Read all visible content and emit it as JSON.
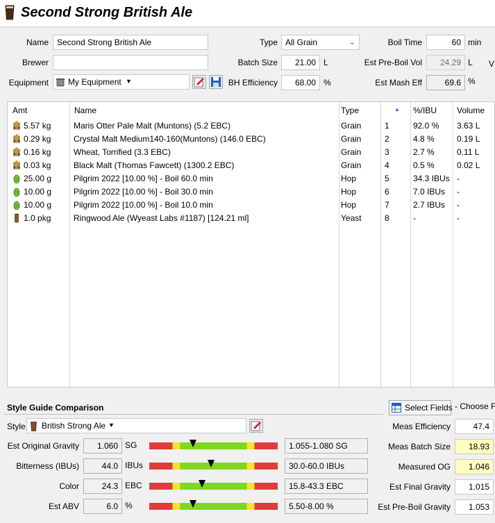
{
  "recipe": {
    "title": "Second Strong British Ale"
  },
  "form": {
    "name_label": "Name",
    "name_value": "Second Strong British Ale",
    "brewer_label": "Brewer",
    "brewer_value": "",
    "equipment_label": "Equipment",
    "equipment_value": "My Equipment",
    "type_label": "Type",
    "type_value": "All Grain",
    "batch_size_label": "Batch Size",
    "batch_size_value": "21.00",
    "batch_size_unit": "L",
    "bh_eff_label": "BH Efficiency",
    "bh_eff_value": "68.00",
    "bh_eff_unit": "%",
    "boil_time_label": "Boil Time",
    "boil_time_value": "60",
    "boil_time_unit": "min",
    "pre_boil_label": "Est Pre-Boil Vol",
    "pre_boil_value": "24.29",
    "pre_boil_unit": "L",
    "mash_eff_label": "Est Mash Eff",
    "mash_eff_value": "69.6",
    "mash_eff_unit": "%",
    "cut_letter": "V"
  },
  "table": {
    "headers": {
      "amt": "Amt",
      "name": "Name",
      "type": "Type",
      "pct": "%/IBU",
      "volume": "Volume"
    },
    "rows": [
      {
        "icon": "grain-icon",
        "amt": "5.57 kg",
        "name": "Maris Otter Pale Malt (Muntons) (5.2 EBC)",
        "type": "Grain",
        "num": "1",
        "pct": "92.0 %",
        "volume": "3.63 L"
      },
      {
        "icon": "grain-icon",
        "amt": "0.29 kg",
        "name": "Crystal Malt Medium140-160(Muntons) (146.0 EBC)",
        "type": "Grain",
        "num": "2",
        "pct": "4.8 %",
        "volume": "0.19 L"
      },
      {
        "icon": "grain-icon",
        "amt": "0.16 kg",
        "name": "Wheat, Torrified (3.3 EBC)",
        "type": "Grain",
        "num": "3",
        "pct": "2.7 %",
        "volume": "0.11 L"
      },
      {
        "icon": "grain-icon",
        "amt": "0.03 kg",
        "name": "Black Malt (Thomas Fawcett) (1300.2 EBC)",
        "type": "Grain",
        "num": "4",
        "pct": "0.5 %",
        "volume": "0.02 L"
      },
      {
        "icon": "hop-icon",
        "amt": "25.00 g",
        "name": "Pilgrim 2022 [10.00 %] - Boil 60.0 min",
        "type": "Hop",
        "num": "5",
        "pct": "34.3 IBUs",
        "volume": "-"
      },
      {
        "icon": "hop-icon",
        "amt": "10.00 g",
        "name": "Pilgrim 2022 [10.00 %] - Boil 30.0 min",
        "type": "Hop",
        "num": "6",
        "pct": "7.0 IBUs",
        "volume": "-"
      },
      {
        "icon": "hop-icon",
        "amt": "10.00 g",
        "name": "Pilgrim 2022 [10.00 %] - Boil 10.0 min",
        "type": "Hop",
        "num": "7",
        "pct": "2.7 IBUs",
        "volume": "-"
      },
      {
        "icon": "yeast-icon",
        "amt": "1.0 pkg",
        "name": "Ringwood Ale (Wyeast Labs #1187) [124.21 ml]",
        "type": "Yeast",
        "num": "8",
        "pct": "-",
        "volume": "-"
      }
    ]
  },
  "style_guide": {
    "title": "Style Guide Comparison",
    "style_label": "Style",
    "style_value": "British Strong Ale",
    "rows": [
      {
        "label": "Est Original Gravity",
        "value": "1.060",
        "unit": "SG",
        "range": "1.055-1.080 SG",
        "level": 0.34
      },
      {
        "label": "Bitterness (IBUs)",
        "value": "44.0",
        "unit": "IBUs",
        "range": "30.0-60.0 IBUs",
        "level": 0.48
      },
      {
        "label": "Color",
        "value": "24.3",
        "unit": "EBC",
        "range": "15.8-43.3 EBC",
        "level": 0.41
      },
      {
        "label": "Est ABV",
        "value": "6.0",
        "unit": "%",
        "range": "5.50-8.00 %",
        "level": 0.34
      }
    ]
  },
  "right_panel": {
    "select_fields": "Select Fields",
    "choose_text": "- Choose F",
    "meas_eff_label": "Meas Efficiency",
    "meas_eff_value": "47.4",
    "meas_batch_label": "Meas Batch Size",
    "meas_batch_value": "18.93",
    "meas_og_label": "Measured OG",
    "meas_og_value": "1.046",
    "est_fg_label": "Est Final Gravity",
    "est_fg_value": "1.015",
    "est_pre_label": "Est Pre-Boil Gravity",
    "est_pre_value": "1.053"
  },
  "colors": {
    "accent": "#1e6fd9",
    "bar_red": "#e23b3b",
    "bar_yellow": "#f2e52a",
    "bar_green": "#7fd81f",
    "highlight": "#ffffc0"
  }
}
